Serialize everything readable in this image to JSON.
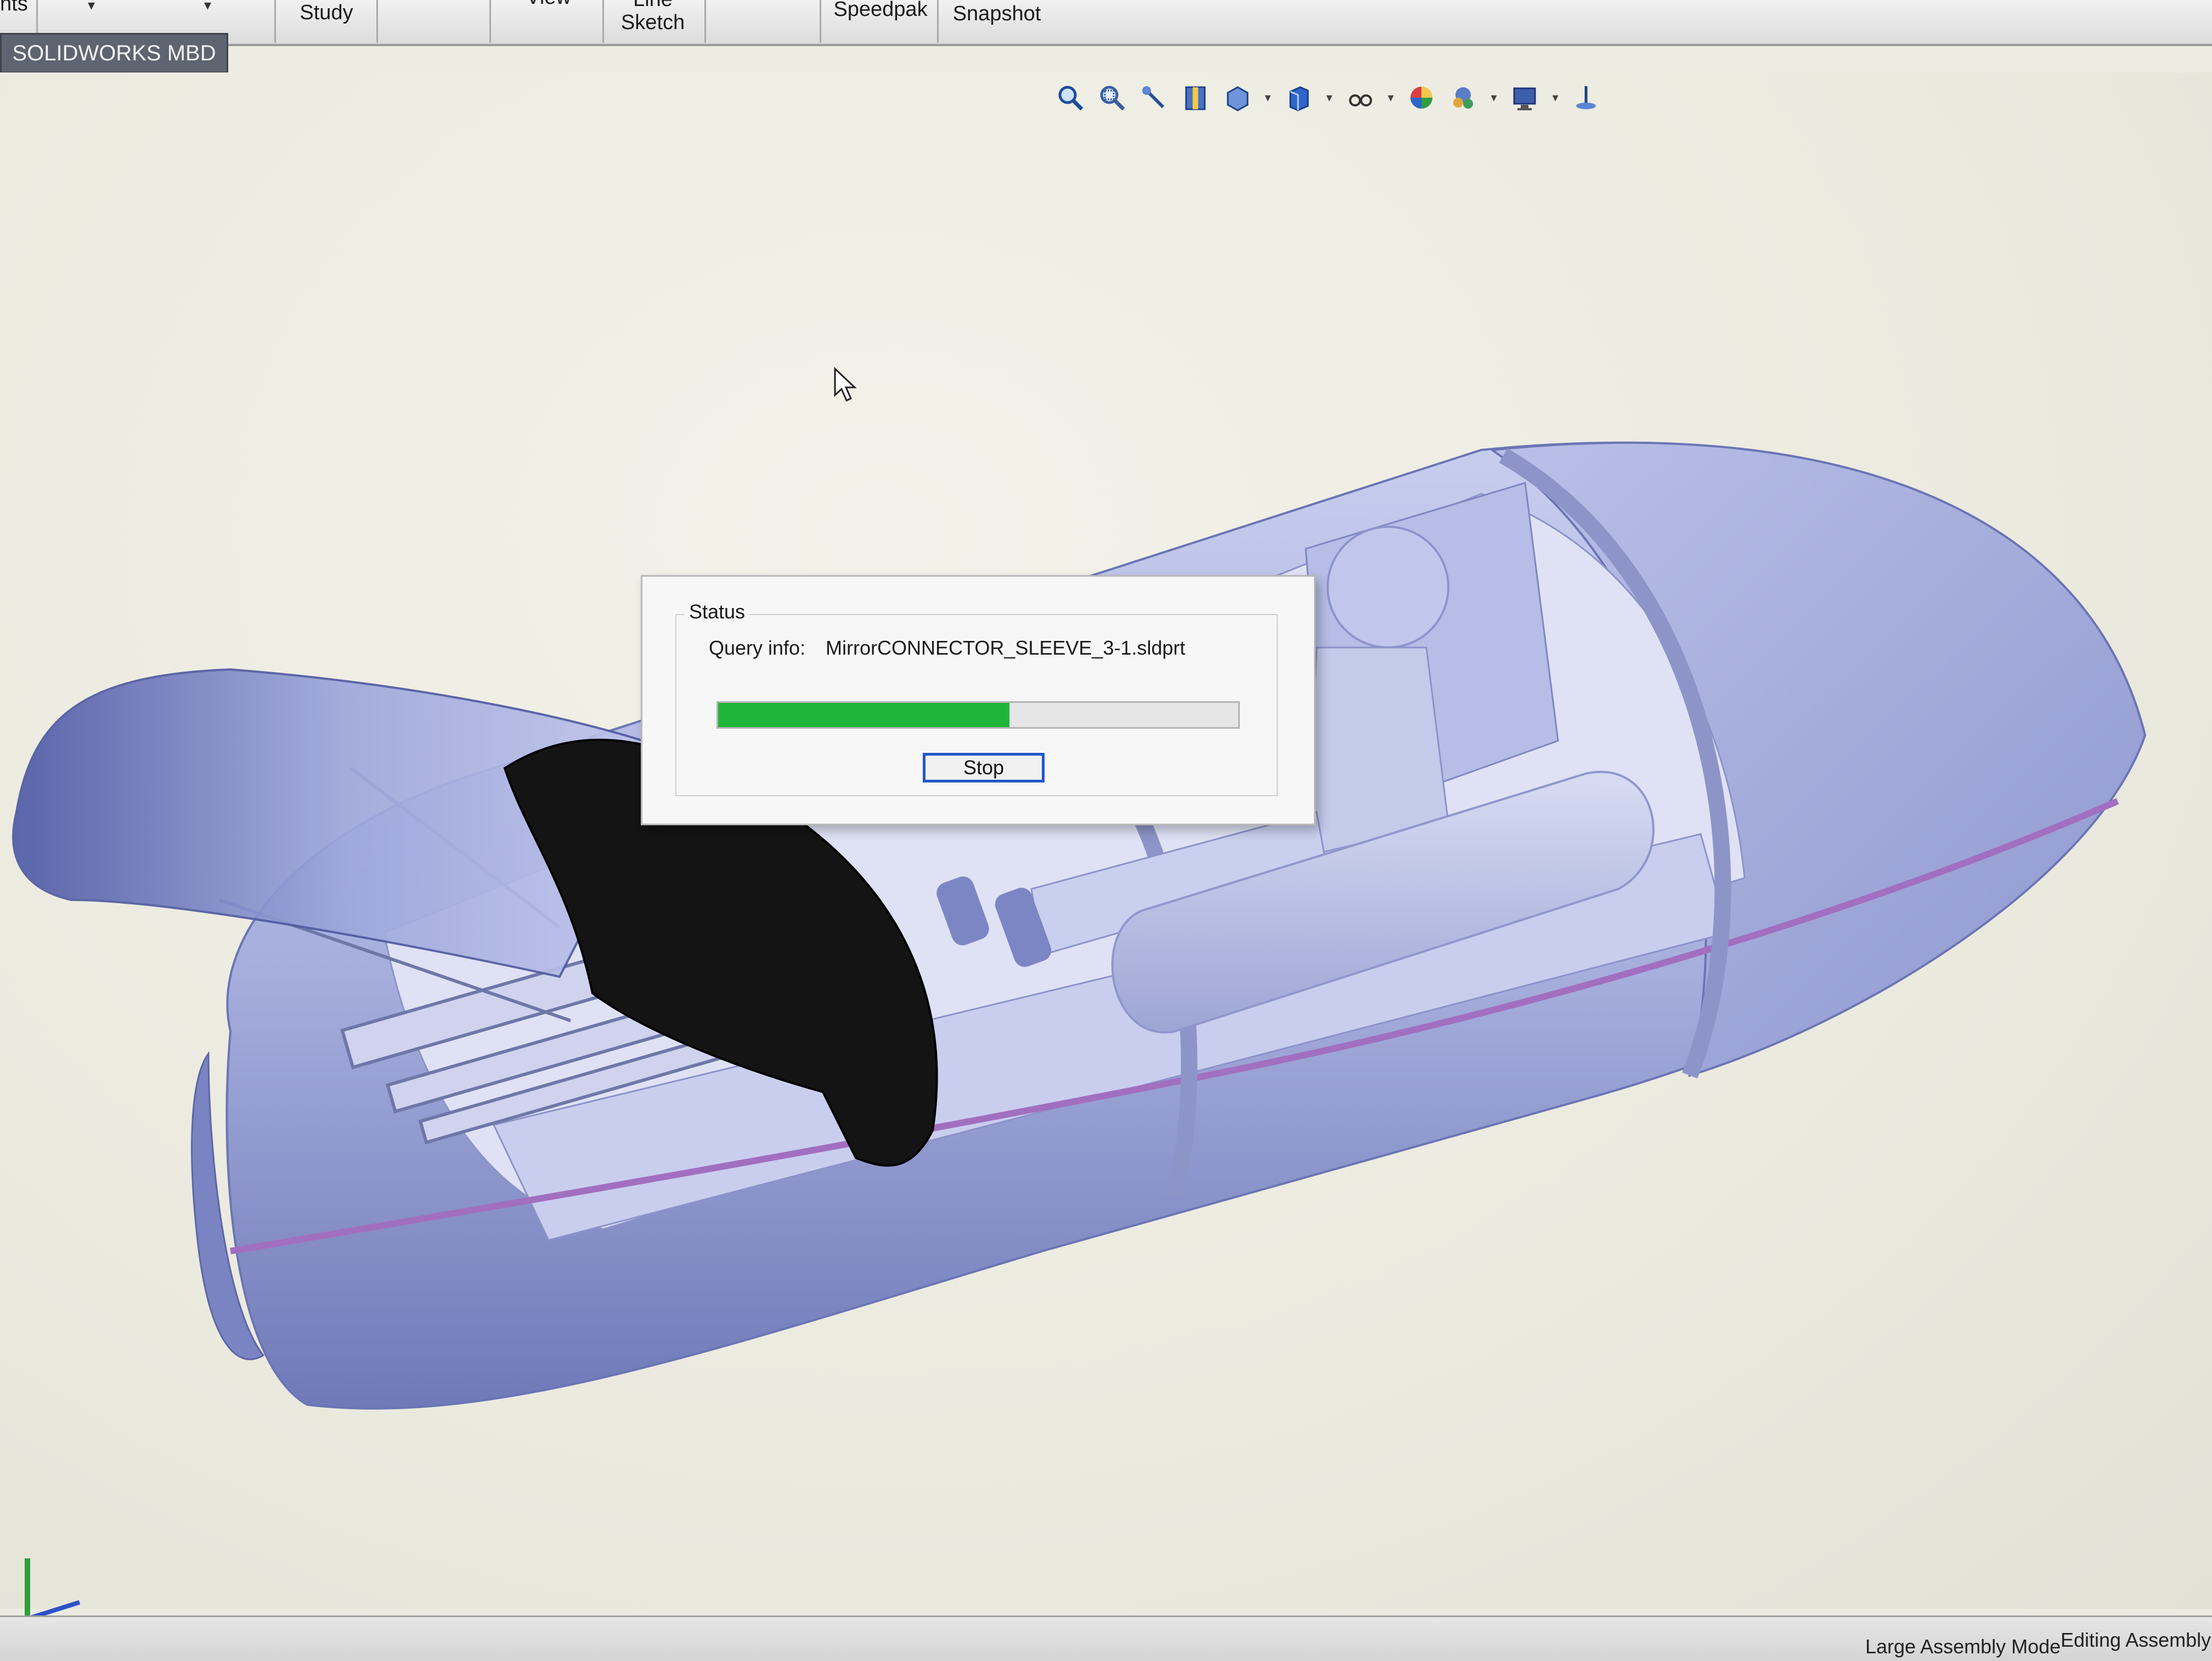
{
  "ribbon": {
    "items": [
      {
        "label": "nts"
      },
      {
        "label": "Study"
      },
      {
        "label": "View"
      },
      {
        "label": "Line\nSketch"
      },
      {
        "label": "Speedpak"
      },
      {
        "label": "Snapshot"
      }
    ]
  },
  "tabs": {
    "active_label": "SOLIDWORKS MBD"
  },
  "heads_up_toolbar": {
    "icons": [
      "zoom-to-fit-icon",
      "zoom-to-area-icon",
      "previous-view-icon",
      "section-view-icon",
      "view-orientation-icon",
      "display-style-icon",
      "hide-show-items-icon",
      "edit-appearance-icon",
      "apply-scene-icon",
      "view-settings-icon",
      "triad-view-icon"
    ]
  },
  "status_dialog": {
    "group_title": "Status",
    "query_label": "Query info:",
    "query_value": "MirrorCONNECTOR_SLEEVE_3-1.sldprt",
    "progress": 0.56,
    "progress_color": "#1fb53a",
    "stop_label": "Stop"
  },
  "statusbar": {
    "mode": "Large Assembly Mode",
    "editing": "Editing Assembly"
  },
  "colors": {
    "background": "#ecebe2",
    "model_body": "#a9b0dd",
    "accent_stripe": "#a26fc0",
    "button_focus": "#2357c7"
  }
}
